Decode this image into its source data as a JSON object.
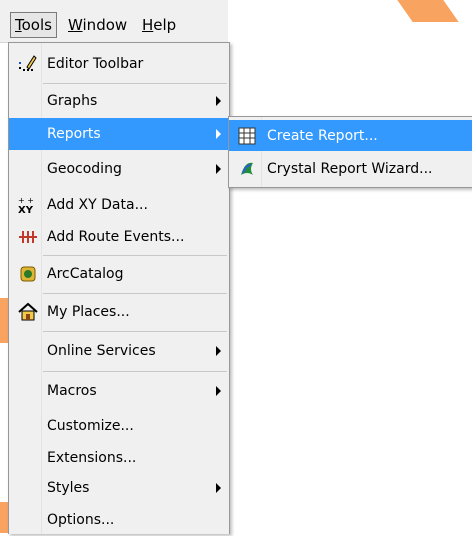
{
  "menubar": {
    "items": [
      {
        "label": "Tools"
      },
      {
        "label": "Window"
      },
      {
        "label": "Help"
      }
    ]
  },
  "tools_menu": {
    "items": [
      {
        "label": "Editor Toolbar",
        "icon": "editor-toolbar-icon"
      },
      {
        "label": "Graphs",
        "submenu": true
      },
      {
        "label": "Reports",
        "submenu": true,
        "highlighted": true
      },
      {
        "label": "Geocoding",
        "submenu": true
      },
      {
        "label": "Add XY Data...",
        "icon": "add-xy-data-icon"
      },
      {
        "label": "Add Route Events...",
        "icon": "add-route-events-icon"
      },
      {
        "label": "ArcCatalog",
        "icon": "arccatalog-icon"
      },
      {
        "label": "My Places...",
        "icon": "my-places-icon"
      },
      {
        "label": "Online Services",
        "submenu": true
      },
      {
        "label": "Macros",
        "submenu": true
      },
      {
        "label": "Customize..."
      },
      {
        "label": "Extensions..."
      },
      {
        "label": "Styles",
        "submenu": true
      },
      {
        "label": "Options..."
      }
    ]
  },
  "reports_submenu": {
    "items": [
      {
        "label": "Create Report...",
        "icon": "create-report-icon",
        "highlighted": true
      },
      {
        "label": "Crystal Report Wizard...",
        "icon": "crystal-report-wizard-icon"
      }
    ]
  },
  "colors": {
    "highlight": "#3399ff",
    "menu_bg": "#f0f0f0",
    "accent_orange": "#f8a35f"
  }
}
